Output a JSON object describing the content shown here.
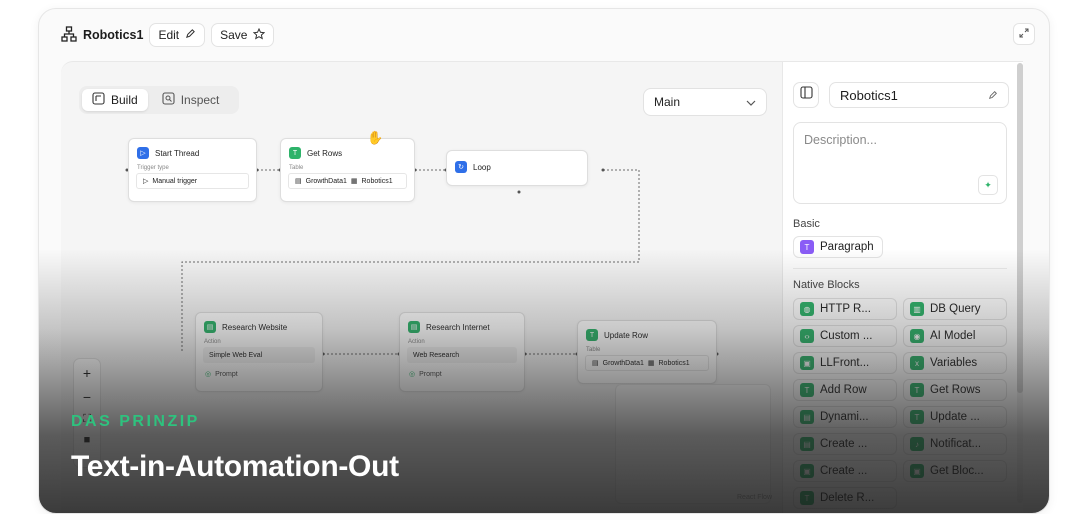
{
  "topbar": {
    "title": "Robotics1",
    "edit_label": "Edit",
    "save_label": "Save"
  },
  "canvas": {
    "tabs": [
      {
        "label": "Build",
        "active": true
      },
      {
        "label": "Inspect",
        "active": false
      }
    ],
    "select_value": "Main",
    "attribution": "React Flow",
    "nodes": {
      "start_thread": {
        "title": "Start Thread",
        "sub": "Trigger type",
        "field": "Manual trigger"
      },
      "get_rows": {
        "title": "Get Rows",
        "sub": "Table",
        "field_a": "GrowthData1",
        "field_b": "Robotics1"
      },
      "loop": {
        "title": "Loop"
      },
      "research_website": {
        "title": "Research Website",
        "sub": "Action",
        "field": "Simple Web Eval",
        "prompt": "Prompt"
      },
      "research_internet": {
        "title": "Research Internet",
        "sub": "Action",
        "field": "Web Research",
        "prompt": "Prompt"
      },
      "update_row": {
        "title": "Update Row",
        "sub": "Table",
        "field_a": "GrowthData1",
        "field_b": "Robotics1"
      }
    },
    "zoom": {
      "plus": "+",
      "minus": "−"
    }
  },
  "right_panel": {
    "name_value": "Robotics1",
    "description_placeholder": "Description...",
    "basic_label": "Basic",
    "basic_items": [
      {
        "label": "Paragraph",
        "color": "#8a5cf6"
      }
    ],
    "native_label": "Native Blocks",
    "native_items": [
      "HTTP R...",
      "DB Query",
      "Custom ...",
      "AI Model",
      "LLFront...",
      "Variables",
      "Add Row",
      "Get Rows",
      "Dynami...",
      "Update ...",
      "Create ...",
      "Notificat...",
      "Create ...",
      "Get Bloc...",
      "Delete R..."
    ]
  },
  "overlay": {
    "kicker": "DAS PRINZIP",
    "headline": "Text-in-Automation-Out"
  },
  "colors": {
    "accent_green": "#2eb36a",
    "accent_blue": "#2f6fe8",
    "kicker_green": "#2ec27e"
  }
}
